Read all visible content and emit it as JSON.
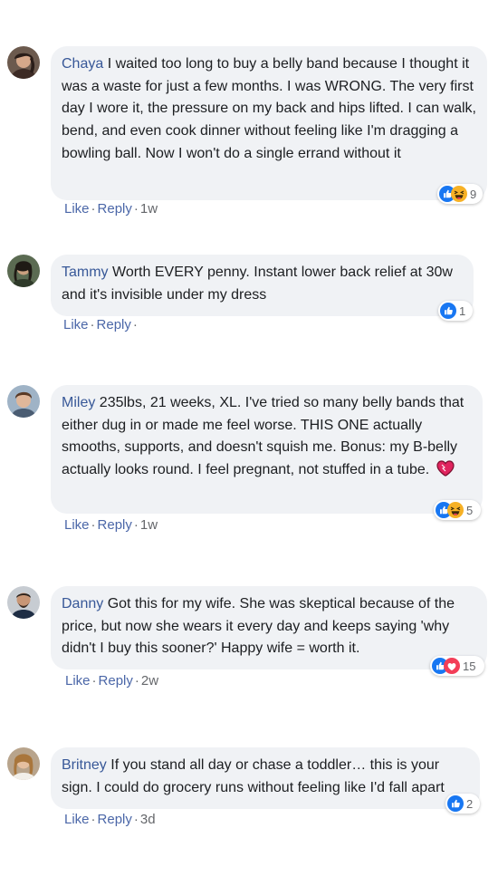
{
  "comments": [
    {
      "name": "Chaya",
      "text": "I waited too long to buy a belly band because I thought it was a waste for just a few months. I was WRONG. The very first day I wore it, the pressure on my back and hips lifted. I can walk, bend, and even cook dinner without feeling like I'm dragging a bowling ball. Now I won't do a single errand without it",
      "reaction_icons": [
        "like-icon",
        "haha-icon"
      ],
      "reaction_count": "9",
      "like_label": "Like",
      "reply_label": "Reply",
      "time": "1w"
    },
    {
      "name": "Tammy",
      "text": "Worth EVERY penny. Instant lower back relief at 30w and it's invisible under my dress",
      "reaction_icons": [
        "like-icon"
      ],
      "reaction_count": "1",
      "like_label": "Like",
      "reply_label": "Reply",
      "time": ""
    },
    {
      "name": "Miley",
      "text": "235lbs, 21 weeks, XL. I've tried so many belly bands that either dug in or made me feel worse. THIS ONE actually smooths, supports, and doesn't squish me. Bonus: my B-belly actually looks round. I feel pregnant, not stuffed in a tube.",
      "emoji": "heart-emoji",
      "reaction_icons": [
        "like-icon",
        "haha-icon"
      ],
      "reaction_count": "5",
      "like_label": "Like",
      "reply_label": "Reply",
      "time": "1w"
    },
    {
      "name": "Danny",
      "text": "Got this for my wife. She was skeptical because of the price, but now she wears it every day and keeps saying 'why didn't I buy this sooner?' Happy wife = worth it.",
      "reaction_icons": [
        "like-icon",
        "love-icon"
      ],
      "reaction_count": "15",
      "like_label": "Like",
      "reply_label": "Reply",
      "time": "2w"
    },
    {
      "name": "Britney",
      "text": "If you stand all day or chase a toddler… this is your sign. I could do grocery runs without feeling like I'd fall apart",
      "reaction_icons": [
        "like-icon"
      ],
      "reaction_count": "2",
      "like_label": "Like",
      "reply_label": "Reply",
      "time": "3d"
    }
  ],
  "colors": {
    "bubble": "#f0f2f5",
    "name": "#385898",
    "like_blue": "#1877f2",
    "haha_yellow": "#f7b125",
    "love_red": "#f33e58",
    "meta_gray": "#65676b"
  }
}
